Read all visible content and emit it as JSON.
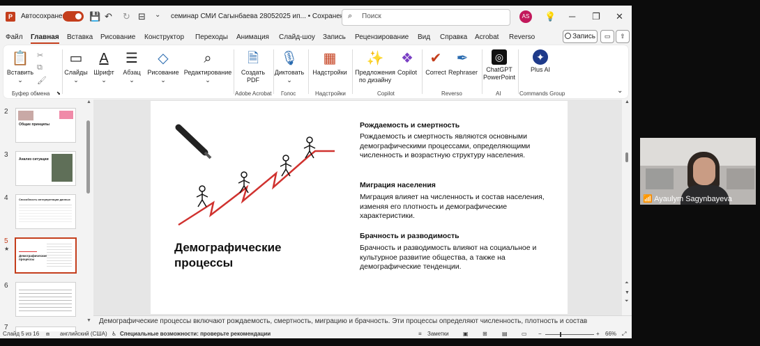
{
  "titlebar": {
    "autosave_label": "Автосохранение",
    "doc_title": "семинар СМИ Сагынбаева 28052025 ип... • Сохранено ⌄",
    "search_placeholder": "Поиск",
    "avatar_initials": "AS",
    "minimize": "─",
    "maximize": "❐",
    "close": "✕",
    "undo": "↶",
    "redo": "↻",
    "quick_access": "⊟"
  },
  "menu": {
    "items": [
      "Файл",
      "Главная",
      "Вставка",
      "Рисование",
      "Конструктор",
      "Переходы",
      "Анимация",
      "Слайд-шоу",
      "Запись",
      "Рецензирование",
      "Вид",
      "Справка",
      "Acrobat",
      "Reverso"
    ],
    "record_label": "Запись"
  },
  "ribbon": {
    "paste": "Вставить",
    "clipboard_group": "Буфер обмена",
    "slides": "Слайды",
    "font": "Шрифт",
    "paragraph": "Абзац",
    "drawing": "Рисование",
    "editing": "Редактирование",
    "create_pdf": "Создать PDF",
    "acrobat_group": "Adobe Acrobat",
    "dictate": "Диктовать",
    "voice_group": "Голос",
    "addins": "Надстройки",
    "addins_group": "Надстройки",
    "designer": "Предложения по дизайну",
    "copilot": "Copilot",
    "copilot_group": "Copilot",
    "correct": "Correct",
    "rephraser": "Rephraser",
    "reverso_group": "Reverso",
    "chatgpt": "ChatGPT PowerPoint",
    "ai_group": "AI",
    "plus_ai": "Plus AI",
    "commands_group": "Commands Group"
  },
  "thumbnails": {
    "numbers": [
      "2",
      "3",
      "4",
      "5",
      "6",
      "7"
    ],
    "current": "5",
    "thumb2_title": "Общие принципы",
    "thumb3_title": "Анализ ситуации",
    "thumb4_title": "Способность интерпретации данных",
    "thumb5_title": "Демографические процессы"
  },
  "slide": {
    "title": "Демографические процессы",
    "s1_heading": "Рождаемость и смертность",
    "s1_text": "Рождаемость и смертность являются основными демографическими процессами, определяющими численность и возрастную структуру населения.",
    "s2_heading": "Миграция населения",
    "s2_text": "Миграция влияет на численность и состав населения, изменяя его плотность и демографические характеристики.",
    "s3_heading": "Брачность и разводимость",
    "s3_text": "Брачность и разводимость влияют на социальное и культурное развитие общества, а также на демографические тенденции."
  },
  "notes": {
    "text": "Демографические процессы включают рождаемость, смертность, миграцию и брачность. Эти процессы определяют численность, плотность и состав"
  },
  "status": {
    "slide_counter": "Слайд 5 из 16",
    "language": "английский (США)",
    "accessibility": "Специальные возможности: проверьте рекомендации",
    "notes_btn": "Заметки",
    "zoom": "66%"
  },
  "webcam": {
    "participant_name": "Ayaulym Sagynbayeva"
  }
}
